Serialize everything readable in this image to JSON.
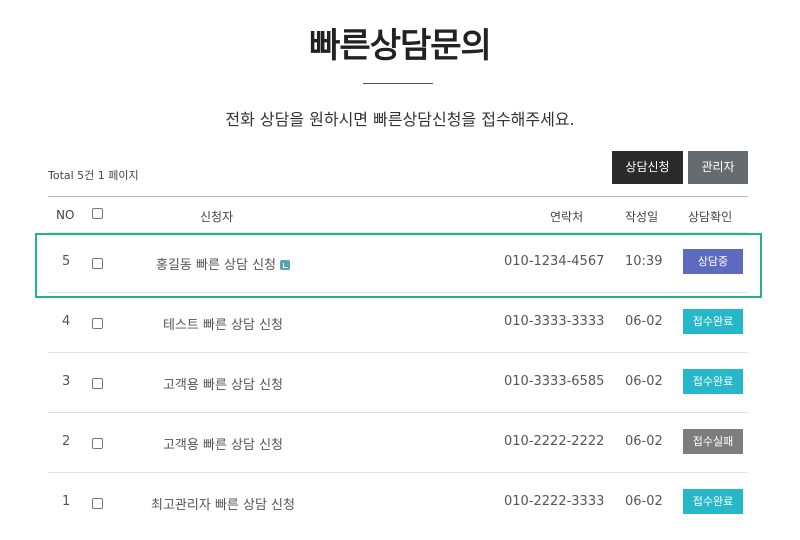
{
  "page": {
    "title": "빠른상담문의",
    "subtitle": "전화 상담을 원하시면 빠른상담신청을 접수해주세요.",
    "total_text": "Total 5건 1 페이지"
  },
  "buttons": {
    "apply": "상담신청",
    "admin": "관리자"
  },
  "table": {
    "headers": {
      "no": "NO",
      "name": "신청자",
      "phone": "연락처",
      "date": "작성일",
      "status": "상담확인"
    },
    "rows": [
      {
        "no": "5",
        "name": "홍길동 빠른 상담 신청",
        "phone": "010-1234-4567",
        "date": "10:39",
        "status": "상담중",
        "status_color": "#5c6bc0",
        "new": true
      },
      {
        "no": "4",
        "name": "테스트 빠른 상담 신청",
        "phone": "010-3333-3333",
        "date": "06-02",
        "status": "접수완료",
        "status_color": "#26b8c9",
        "new": false
      },
      {
        "no": "3",
        "name": "고객용 빠른 상담 신청",
        "phone": "010-3333-6585",
        "date": "06-02",
        "status": "접수완료",
        "status_color": "#26b8c9",
        "new": false
      },
      {
        "no": "2",
        "name": "고객용 빠른 상담 신청",
        "phone": "010-2222-2222",
        "date": "06-02",
        "status": "접수실패",
        "status_color": "#7d7d7d",
        "new": false
      },
      {
        "no": "1",
        "name": "최고관리자 빠른 상담 신청",
        "phone": "010-2222-3333",
        "date": "06-02",
        "status": "접수완료",
        "status_color": "#26b8c9",
        "new": false
      }
    ]
  },
  "colors": {
    "highlight_border": "#20b590"
  }
}
